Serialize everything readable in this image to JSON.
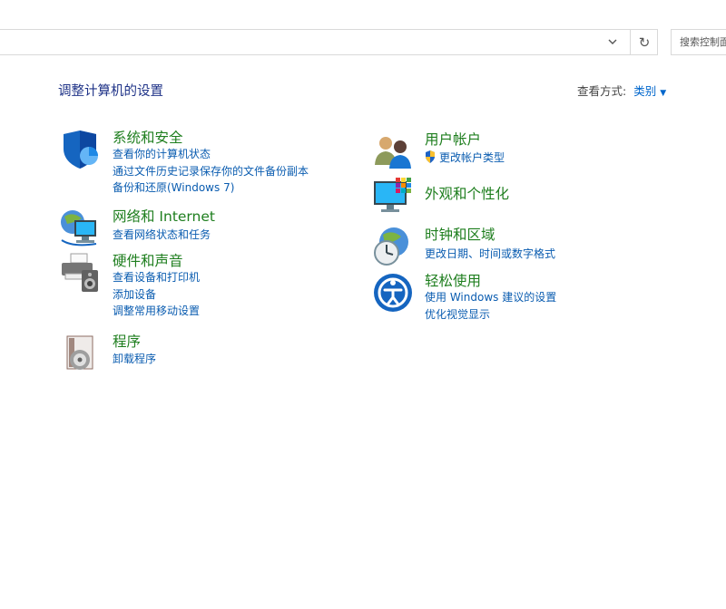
{
  "search": {
    "placeholder": "搜索控制面板"
  },
  "page": {
    "title": "调整计算机的设置"
  },
  "view_by": {
    "label": "查看方式:",
    "value": "类别"
  },
  "categories_left": [
    {
      "title": "系统和安全",
      "icon": "shield-icon",
      "links": [
        "查看你的计算机状态",
        "通过文件历史记录保存你的文件备份副本",
        "备份和还原(Windows 7)"
      ]
    },
    {
      "title": "网络和 Internet",
      "icon": "network-globe-icon",
      "links": [
        "查看网络状态和任务"
      ]
    },
    {
      "title": "硬件和声音",
      "icon": "printer-speaker-icon",
      "links": [
        "查看设备和打印机",
        "添加设备",
        "调整常用移动设置"
      ]
    },
    {
      "title": "程序",
      "icon": "programs-disc-icon",
      "links": [
        "卸载程序"
      ]
    }
  ],
  "categories_right": [
    {
      "title": "用户帐户",
      "icon": "users-icon",
      "links": [
        "更改帐户类型"
      ]
    },
    {
      "title": "外观和个性化",
      "icon": "monitor-palette-icon",
      "links": []
    },
    {
      "title": "时钟和区域",
      "icon": "clock-globe-icon",
      "links": [
        "更改日期、时间或数字格式"
      ]
    },
    {
      "title": "轻松使用",
      "icon": "ease-of-access-icon",
      "links": [
        "使用 Windows 建议的设置",
        "优化视觉显示"
      ]
    }
  ],
  "colors": {
    "title": "#1e3287",
    "category": "#1e7e1e",
    "link": "#0a5cb0"
  }
}
